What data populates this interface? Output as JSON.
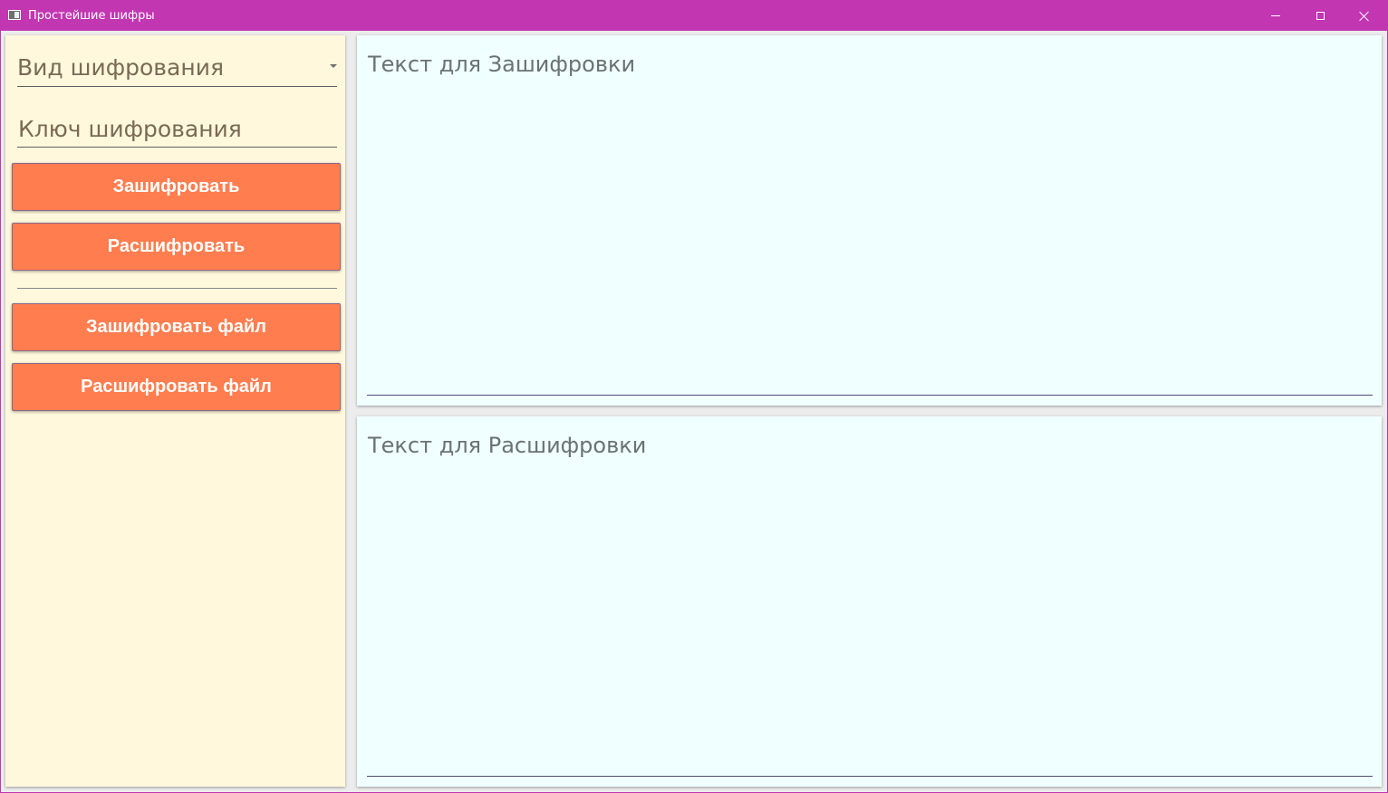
{
  "window": {
    "title": "Простейшие шифры",
    "controls": {
      "minimize_icon": "minimize-icon",
      "maximize_icon": "maximize-icon",
      "close_icon": "close-icon"
    }
  },
  "sidebar": {
    "cipher_type_placeholder": "Вид шифрования",
    "key_placeholder": "Ключ шифрования",
    "encrypt_label": "Зашифровать",
    "decrypt_label": "Расшифровать",
    "encrypt_file_label": "Зашифровать файл",
    "decrypt_file_label": "Расшифровать файл"
  },
  "main": {
    "plaintext_placeholder": "Текст для Зашифровки",
    "ciphertext_placeholder": "Текст для Расшифровки"
  },
  "colors": {
    "titlebar": "#c236b2",
    "sidebar_bg": "#fff8dc",
    "button_bg": "#ff7d4f",
    "text_area_bg": "#f0ffff"
  }
}
